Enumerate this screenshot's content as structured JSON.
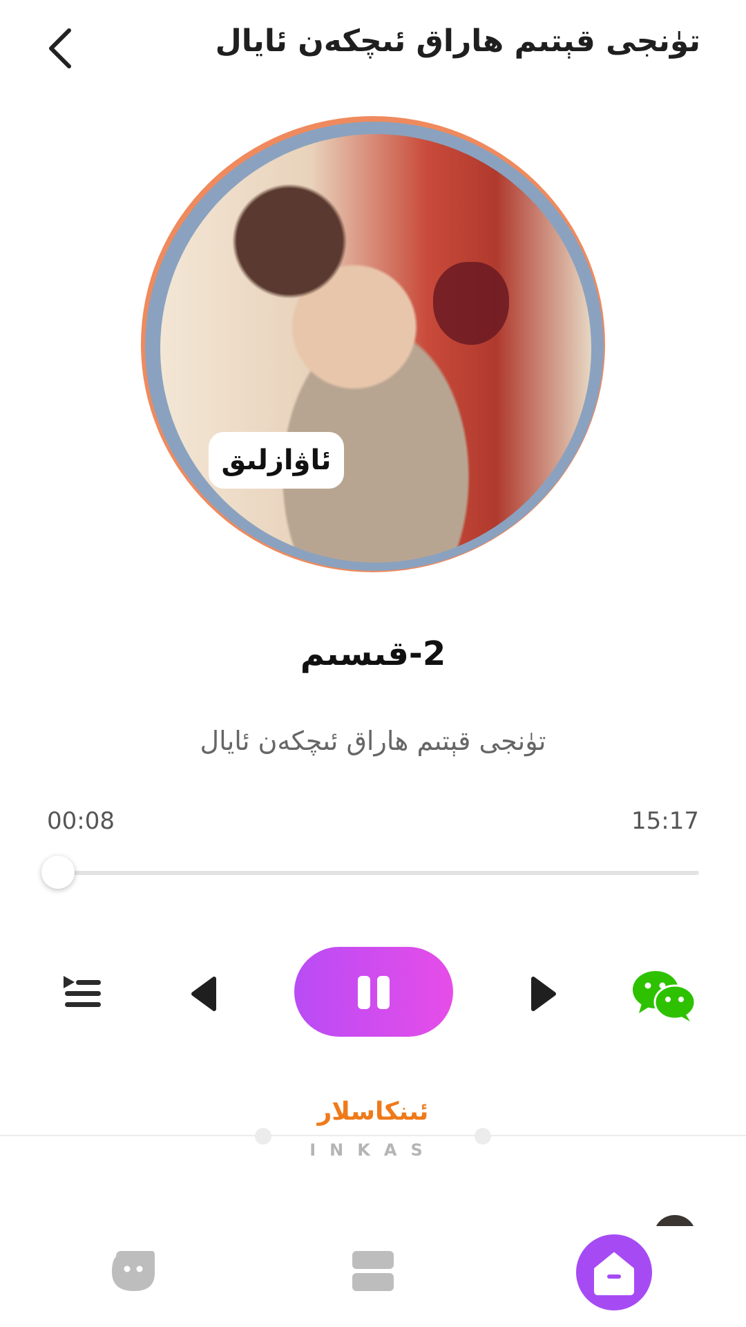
{
  "header": {
    "title": "تۈنجى قېتىم هاراق ئىچكەن ئايال",
    "back_icon": "chevron-left-icon"
  },
  "cover": {
    "badge_text": "ئاۋازلىق",
    "ring_colors": {
      "outer": "#ef8a5e",
      "inner": "#8aa2bf"
    }
  },
  "track": {
    "title": "2-قىسىم",
    "subtitle": "تۈنجى قېتىم هاراق ئىچكەن ئايال"
  },
  "player": {
    "current_time": "00:08",
    "total_time": "15:17",
    "progress_fraction": 0.009,
    "is_playing": true,
    "accent_gradient": [
      "#b94cf5",
      "#e64de8"
    ]
  },
  "controls": {
    "playlist_icon": "playlist-icon",
    "prev_icon": "previous-icon",
    "pause_icon": "pause-icon",
    "next_icon": "next-icon",
    "share_icon": "wechat-icon",
    "share_color": "#2dc100"
  },
  "section": {
    "title": "ئىنكاسلار",
    "subtitle": "INKAS",
    "title_color": "#ef7a1a"
  },
  "nav": {
    "items": [
      {
        "icon": "bot-face-icon",
        "active": false
      },
      {
        "icon": "list-icon",
        "active": false
      },
      {
        "icon": "home-icon",
        "active": true,
        "color": "#a64bf4"
      }
    ]
  }
}
